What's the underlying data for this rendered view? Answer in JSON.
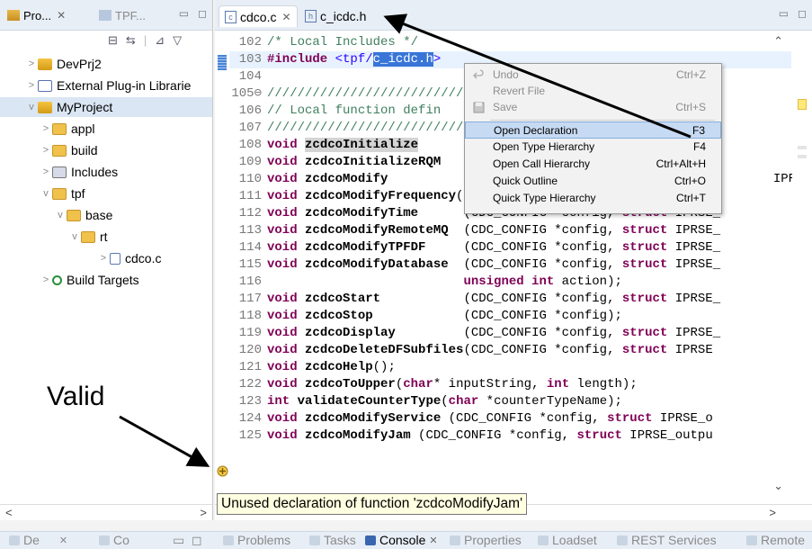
{
  "explorer": {
    "tabs": [
      {
        "label": "Pro...",
        "icon": "package-explorer-icon"
      },
      {
        "label": "TPF...",
        "icon": "tpf-explorer-icon"
      }
    ],
    "tree": [
      {
        "label": "DevPrj2",
        "arrow": ">",
        "icon": "project-icon"
      },
      {
        "label": "External Plug-in Librarie",
        "arrow": ">",
        "icon": "external-library-icon"
      },
      {
        "label": "MyProject",
        "arrow": "v",
        "icon": "project-icon"
      },
      {
        "label": "appl",
        "arrow": ">",
        "icon": "folder-icon"
      },
      {
        "label": "build",
        "arrow": ">",
        "icon": "folder-icon"
      },
      {
        "label": "Includes",
        "arrow": ">",
        "icon": "includes-icon"
      },
      {
        "label": "tpf",
        "arrow": "v",
        "icon": "folder-icon"
      },
      {
        "label": "base",
        "arrow": "v",
        "icon": "folder-icon"
      },
      {
        "label": "rt",
        "arrow": "v",
        "icon": "folder-icon"
      },
      {
        "label": "cdco.c",
        "arrow": ">",
        "icon": "c-file-icon"
      },
      {
        "label": "Build Targets",
        "arrow": ">",
        "icon": "build-targets-icon"
      }
    ]
  },
  "editor": {
    "tabs": [
      {
        "label": "cdco.c",
        "close": "✕"
      },
      {
        "label": "c_icdc.h"
      }
    ],
    "lines": [
      {
        "n": "102",
        "html": "<span class=\"cm\">/* Local Includes */</span>"
      },
      {
        "n": "103",
        "html": "<span class=\"kw\">#include</span> <span class=\"st\">&lt;tpf/<span class=\"sel\">c_icdc.h</span>&gt;</span>"
      },
      {
        "n": "104",
        "html": ""
      },
      {
        "n": "105⊖",
        "html": "<span class=\"cm\">//////////////////////////////////////////////////</span>"
      },
      {
        "n": "106",
        "html": "<span class=\"cm\">// Local function defin</span>"
      },
      {
        "n": "107",
        "html": "<span class=\"cm\">//////////////////////////////////////////////////</span>"
      },
      {
        "n": "108",
        "html": "<span class=\"kw\">void</span> <span class=\"fn sel2\">zcdcoInitialize</span>  "
      },
      {
        "n": "109",
        "html": "<span class=\"kw\">void</span> <span class=\"fn\">zcdcoInitializeRQM</span>"
      },
      {
        "n": "110",
        "html": "<span class=\"kw\">void</span> <span class=\"fn\">zcdcoModify</span>                                                   IPRSE_"
      },
      {
        "n": "111",
        "html": "<span class=\"kw\">void</span> <span class=\"fn\">zcdcoModifyFrequency</span>(CDC_CONFIG *config, <span class=\"kw\">struct</span> IPRSE_"
      },
      {
        "n": "112",
        "html": "<span class=\"kw\">void</span> <span class=\"fn\">zcdcoModifyTime</span>      (CDC_CONFIG *config, <span class=\"kw\">struct</span> IPRSE_"
      },
      {
        "n": "113",
        "html": "<span class=\"kw\">void</span> <span class=\"fn\">zcdcoModifyRemoteMQ</span>  (CDC_CONFIG *config, <span class=\"kw\">struct</span> IPRSE_"
      },
      {
        "n": "114",
        "html": "<span class=\"kw\">void</span> <span class=\"fn\">zcdcoModifyTPFDF</span>     (CDC_CONFIG *config, <span class=\"kw\">struct</span> IPRSE_"
      },
      {
        "n": "115",
        "html": "<span class=\"kw\">void</span> <span class=\"fn\">zcdcoModifyDatabase</span>  (CDC_CONFIG *config, <span class=\"kw\">struct</span> IPRSE_"
      },
      {
        "n": "116",
        "html": "                          <span class=\"kw\">unsigned int</span> action);"
      },
      {
        "n": "117",
        "html": "<span class=\"kw\">void</span> <span class=\"fn\">zcdcoStart</span>           (CDC_CONFIG *config, <span class=\"kw\">struct</span> IPRSE_"
      },
      {
        "n": "118",
        "html": "<span class=\"kw\">void</span> <span class=\"fn\">zcdcoStop</span>            (CDC_CONFIG *config);"
      },
      {
        "n": "119",
        "html": "<span class=\"kw\">void</span> <span class=\"fn\">zcdcoDisplay</span>         (CDC_CONFIG *config, <span class=\"kw\">struct</span> IPRSE_"
      },
      {
        "n": "120",
        "html": "<span class=\"kw\">void</span> <span class=\"fn\">zcdcoDeleteDFSubfiles</span>(CDC_CONFIG *config, <span class=\"kw\">struct</span> IPRSE"
      },
      {
        "n": "121",
        "html": "<span class=\"kw\">void</span> <span class=\"fn\">zcdcoHelp</span>();"
      },
      {
        "n": "122",
        "html": "<span class=\"kw\">void</span> <span class=\"fn\">zcdcoToUpper</span>(<span class=\"kw\">char</span>* inputString, <span class=\"kw\">int</span> length);"
      },
      {
        "n": "123",
        "html": "<span class=\"kw\">int</span> <span class=\"fn\">validateCounterType</span>(<span class=\"kw\">char</span> *counterTypeName);"
      },
      {
        "n": "124",
        "html": "<span class=\"kw\">void</span> <span class=\"fn\">zcdcoModifyService</span> (CDC_CONFIG *config, <span class=\"kw\">struct</span> IPRSE_o"
      },
      {
        "n": "125",
        "html": "<span class=\"kw\">void</span> <span class=\"fn\">zcdcoModifyJam</span> (CDC_CONFIG *config, <span class=\"kw\">struct</span> IPRSE_outpu"
      }
    ]
  },
  "context_menu": {
    "items": [
      {
        "label": "Undo",
        "accel": "Ctrl+Z",
        "disabled": true,
        "icon": "undo-icon"
      },
      {
        "label": "Revert File",
        "accel": "",
        "disabled": true
      },
      {
        "label": "Save",
        "accel": "Ctrl+S",
        "disabled": true,
        "icon": "save-icon"
      },
      {
        "separator": true
      },
      {
        "label": "Open Declaration",
        "accel": "F3",
        "highlighted": true
      },
      {
        "label": "Open Type Hierarchy",
        "accel": "F4"
      },
      {
        "label": "Open Call Hierarchy",
        "accel": "Ctrl+Alt+H"
      },
      {
        "label": "Quick Outline",
        "accel": "Ctrl+O"
      },
      {
        "label": "Quick Type Hierarchy",
        "accel": "Ctrl+T"
      }
    ]
  },
  "tooltip": {
    "text": "Unused declaration of function 'zcdcoModifyJam'"
  },
  "annotation": {
    "label": "Valid"
  },
  "bottom_tabs": [
    {
      "label": "De"
    },
    {
      "label": "Co"
    },
    {
      "label": "Problems"
    },
    {
      "label": "Tasks"
    },
    {
      "label": "Console",
      "active": true
    },
    {
      "label": "Properties"
    },
    {
      "label": "Loadset"
    },
    {
      "label": "REST Services"
    },
    {
      "label": "Remote"
    }
  ]
}
